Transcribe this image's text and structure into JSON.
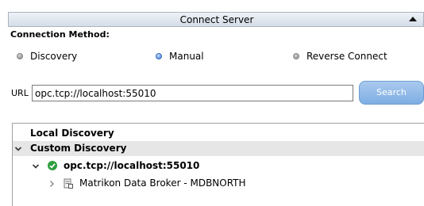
{
  "panel": {
    "title": "Connect Server"
  },
  "connection": {
    "method_label": "Connection Method:",
    "options": [
      {
        "label": "Discovery",
        "selected": false
      },
      {
        "label": "Manual",
        "selected": true
      },
      {
        "label": "Reverse Connect",
        "selected": false
      }
    ]
  },
  "url": {
    "label": "URL",
    "value": "opc.tcp://localhost:55010"
  },
  "search": {
    "label": "Search"
  },
  "tree": {
    "items": [
      {
        "label": "Local Discovery"
      },
      {
        "label": "Custom Discovery"
      },
      {
        "label": "opc.tcp://localhost:55010"
      },
      {
        "label": "Matrikon Data Broker - MDBNORTH"
      }
    ]
  },
  "icons": {
    "collapse": "triangle-up-icon",
    "expanded": "chevron-down-icon",
    "collapsed": "chevron-right-icon",
    "connected": "check-circle-icon",
    "server": "server-icon"
  },
  "colors": {
    "header_top": "#eef2f7",
    "header_bottom": "#d5dde7",
    "search_button": "#8ab7e8",
    "selected_radio": "#2f6fd6",
    "connected_green": "#2e9e3e",
    "row_highlight": "#e6e6e6"
  }
}
